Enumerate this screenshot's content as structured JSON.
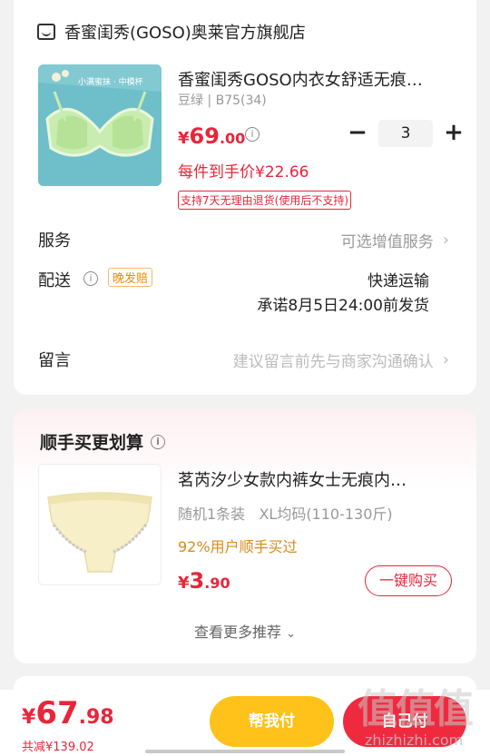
{
  "shop": {
    "icon": "store-icon",
    "name": "香蜜闺秀(GOSO)奥莱官方旗舰店"
  },
  "product": {
    "title": "香蜜闺秀GOSO内衣女舒适无痕…",
    "spec": "豆绿 | B75(34)",
    "price_symbol": "¥",
    "price_int": "69",
    "price_dec": ".00",
    "quantity": "3",
    "minus_label": "−",
    "plus_label": "+",
    "unit_price_text": "每件到手价¥22.66",
    "return_policy": "支持7天无理由退货(使用后不支持)",
    "thumb_caption": "小满蜜抹 · 中模杯"
  },
  "service": {
    "label": "服务",
    "value": "可选增值服务"
  },
  "delivery": {
    "label": "配送",
    "tag": "晚发赔",
    "method": "快递运输",
    "promise": "承诺8月5日24:00前发货"
  },
  "note": {
    "label": "留言",
    "placeholder": "建议留言前先与商家沟通确认"
  },
  "recommend": {
    "title": "顺手买更划算",
    "product_title": "茗芮汐少女款内裤女士无痕内…",
    "spec": "随机1条装   XL均码(110-130斤)",
    "social": "92%用户顺手买过",
    "price_symbol": "¥",
    "price_int": "3",
    "price_dec": ".90",
    "buy_label": "一键购买",
    "more_label": "查看更多推荐"
  },
  "footer": {
    "total_symbol": "¥",
    "total_int": "67",
    "total_dec": ".98",
    "discount": "共减¥139.02",
    "help_pay_label": "帮我付",
    "self_pay_label": "自己付"
  },
  "watermark": {
    "glyphs": "值值值",
    "url": "zhizhizhi.com"
  },
  "colors": {
    "accent": "#e8263a",
    "help_pay": "#ffc21a",
    "social": "#d98b1e"
  }
}
